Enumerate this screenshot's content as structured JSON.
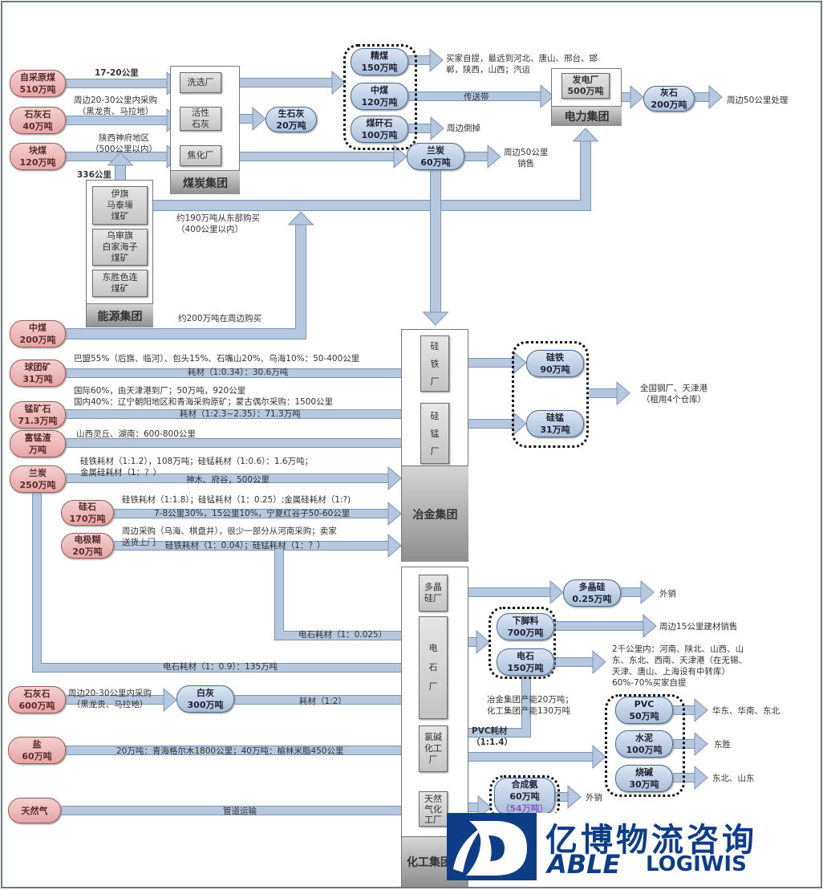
{
  "coal_group": {
    "name": "煤炭集团",
    "plants": [
      "洗选厂",
      "活性\n石灰",
      "焦化厂"
    ]
  },
  "energy_group": {
    "name": "能源集团",
    "mines": [
      "伊旗\n马泰壕\n煤矿",
      "乌审旗\n白家海子\n煤矿",
      "东胜色连\n煤矿"
    ]
  },
  "power_group": {
    "name": "电力集团",
    "plant": "发电厂\n500万吨"
  },
  "metallurgy_group": {
    "name": "冶金集团",
    "plants": [
      "硅\n\n铁\n\n厂",
      "硅\n\n锰\n\n厂"
    ]
  },
  "chemical_group": {
    "name": "化工集团",
    "plants": [
      "多晶\n硅厂",
      "电\n\n石\n\n厂",
      "氯碱\n化工\n厂",
      "天然\n气化\n工厂"
    ]
  },
  "sources": [
    {
      "name": "自采原煤",
      "qty": "510万吨"
    },
    {
      "name": "石灰石",
      "qty": "40万吨"
    },
    {
      "name": "块煤",
      "qty": "120万吨"
    },
    {
      "name": "中煤",
      "qty": "200万吨"
    },
    {
      "name": "球团矿",
      "qty": "31万吨"
    },
    {
      "name": "锰矿石",
      "qty": "71.3万吨"
    },
    {
      "name": "富锰渣",
      "qty": "万吨"
    },
    {
      "name": "兰炭",
      "qty": "250万吨"
    },
    {
      "name": "硅石",
      "qty": "170万吨"
    },
    {
      "name": "电极糊",
      "qty": "20万吨"
    },
    {
      "name": "石灰石",
      "qty": "600万吨"
    },
    {
      "name": "盐",
      "qty": "60万吨"
    },
    {
      "name": "天然气",
      "qty": ""
    }
  ],
  "products": {
    "jingmei": {
      "name": "精煤",
      "qty": "150万吨"
    },
    "zhongmei": {
      "name": "中煤",
      "qty": "120万吨"
    },
    "meiganshi": {
      "name": "煤矸石",
      "qty": "100万吨"
    },
    "shengshihui": {
      "name": "生石灰",
      "qty": "20万吨"
    },
    "lantan": {
      "name": "兰炭",
      "qty": "60万吨"
    },
    "huishi": {
      "name": "灰石",
      "qty": "200万吨"
    },
    "guitie": {
      "name": "硅铁",
      "qty": "90万吨"
    },
    "guimeng": {
      "name": "硅锰",
      "qty": "31万吨"
    },
    "duojinggui": {
      "name": "多晶硅",
      "qty": "0.25万吨"
    },
    "xiajiaoliao": {
      "name": "下脚料",
      "qty": "700万吨"
    },
    "dianshi": {
      "name": "电石",
      "qty": "150万吨"
    },
    "baihui": {
      "name": "白灰",
      "qty": "300万吨"
    },
    "pvc": {
      "name": "PVC",
      "qty": "50万吨"
    },
    "shuini": {
      "name": "水泥",
      "qty": "100万吨"
    },
    "shaojian": {
      "name": "烧碱",
      "qty": "30万吨"
    },
    "hechengan": {
      "name": "合成氨",
      "qty": "60万吨",
      "note": "（54万吨）"
    }
  },
  "labels": {
    "l_17_20": "17-20公里",
    "l_limestone1": "周边20-30公里内采购\n（黑龙贵、马拉地）",
    "l_shaanxi": "陕西神府地区\n（500公里以内）",
    "l_336": "336公里",
    "l_190": "约190万吨从东部购买\n（400公里以内）",
    "l_200": "约200万吨在周边购买",
    "l_jingmei_out": "买家自提，最远到河北、唐山、邢台、邯\n郸，陕西，山西；汽运",
    "l_belt": "传送带",
    "l_dump": "周边倒掉",
    "l_lantan_out": "周边50公里\n销售",
    "l_huishi_out": "周边50公里处理",
    "l_pellet_top": "巴盟55%（后旗、临河）、包头15%、石嘴山20%、乌海10%：50-400公里",
    "l_pellet_arrow": "耗材（1:0.34）：30.6万吨",
    "l_mn_top": "国际60%，由天津港到厂；50万吨，920公里\n国内40%：辽宁朝阳地区和青海采购原矿；蒙古偶尔采购：1500公里",
    "l_mn_arrow": "耗材（1:2.3~2.35）：71.3万吨",
    "l_slag": "山西灵丘、湖南：600-800公里",
    "l_lantan_top": "硅铁耗材（1:1.2），108万吨；硅锰耗材（1:0.6）：1.6万吨；\n金属硅耗材（1：？）",
    "l_lantan_arrow": "神木、府谷，500公里",
    "l_silica_top": "硅铁耗材（1:1.8）；硅锰耗材（1：0.25）;金属硅耗材（1:?)",
    "l_silica_arrow": "7-8公里30%，15公里10%，宁夏红谷子50-60公里",
    "l_electrode_top": "周边采购（乌海、棋盘井），很少一部分从河南采购；卖家\n送货上门",
    "l_electrode_arrow": "硅铁耗材（1：0.04）；硅锰耗材（1：？）",
    "l_ferro_out": "全国钢厂、天津港\n（租用4个仓库）",
    "l_carbide_0025": "电石耗材（1：0.025）",
    "l_carbide_09": "电石耗材（1：0.9）：135万吨",
    "l_limestone2": "周边20-30公里内采购\n（黑龙贵、马拉地）",
    "l_lime_cons": "耗材（1:2）",
    "l_salt": "20万吨：青海格尔木1800公里；40万吨：榆林米脂450公里",
    "l_gas": "管道运输",
    "l_poly_out": "外销",
    "l_scrap_out": "周边15公里建材销售",
    "l_carbide_out": "2千公里内：河南、陕北、山西、山\n东、东北、西南、天津港（在无锡、\n天津、唐山、上海设有中转库）\n60%-70%买家自提",
    "l_capacity": "冶金集团产能20万吨；\n化工集团产能130万吨",
    "l_pvc_cons": "PVC耗材\n（1:1.4）",
    "l_pvc_out": "华东、华南、东北",
    "l_cement_out": "东胜",
    "l_soda_out": "东北、山东",
    "l_ammonia_out": "外销"
  },
  "logo": {
    "cn": "亿博物流咨询",
    "en1": "ABLE",
    "en2": "LOGIWIS"
  },
  "colors": {
    "source_fill": "#e7a5a5",
    "product_fill": "#a9bfda",
    "arrow_fill": "#b5c8e0",
    "logo_blue": "#0e3d86"
  }
}
